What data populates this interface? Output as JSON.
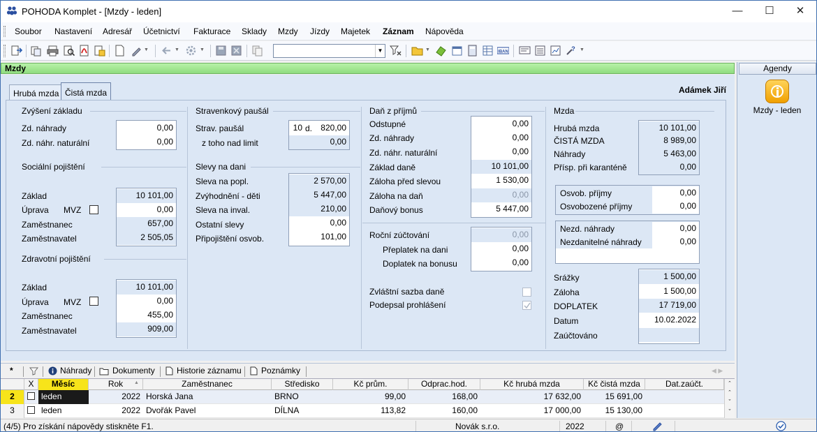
{
  "window": {
    "title": "POHODA Komplet - [Mzdy - leden]"
  },
  "menu": [
    "Soubor",
    "Nastavení",
    "Adresář",
    "Účetnictví",
    "Fakturace",
    "Sklady",
    "Mzdy",
    "Jízdy",
    "Majetek",
    "Záznam",
    "Nápověda"
  ],
  "module_title": "Mzdy",
  "tabs": [
    "Hrubá mzda",
    "Čistá mzda"
  ],
  "employee_name": "Adámek Jiří",
  "zvyseni": {
    "title": "Zvýšení základu",
    "rows": [
      {
        "label": "Zd. náhrady",
        "value": "0,00"
      },
      {
        "label": "Zd. náhr. naturální",
        "value": "0,00"
      }
    ]
  },
  "socialni": {
    "title": "Sociální pojištění",
    "rows": [
      {
        "label": "Základ",
        "value": "10 101,00"
      },
      {
        "label": "Úprava",
        "value": "0,00"
      },
      {
        "label": "Zaměstnanec",
        "value": "657,00"
      },
      {
        "label": "Zaměstnavatel",
        "value": "2 505,05"
      }
    ],
    "mvz": "MVZ"
  },
  "zdravotni": {
    "title": "Zdravotní pojištění",
    "rows": [
      {
        "label": "Základ",
        "value": "10 101,00"
      },
      {
        "label": "Úprava",
        "value": "0,00"
      },
      {
        "label": "Zaměstnanec",
        "value": "455,00"
      },
      {
        "label": "Zaměstnavatel",
        "value": "909,00"
      }
    ],
    "mvz": "MVZ"
  },
  "stravenky": {
    "title": "Stravenkový paušál",
    "rows": [
      {
        "label": "Strav. paušál",
        "days": "10",
        "unit": "d.",
        "value": "820,00"
      },
      {
        "label": "z toho nad limit",
        "value": "0,00"
      }
    ]
  },
  "slevy": {
    "title": "Slevy na dani",
    "rows": [
      {
        "label": "Sleva na popl.",
        "value": "2 570,00"
      },
      {
        "label": "Zvýhodnění - děti",
        "value": "5 447,00"
      },
      {
        "label": "Sleva na inval.",
        "value": "210,00"
      },
      {
        "label": "Ostatní slevy",
        "value": "0,00"
      },
      {
        "label": "Připojištění osvob.",
        "value": "101,00"
      }
    ]
  },
  "dan": {
    "title": "Daň z příjmů",
    "rows": [
      {
        "label": "Odstupné",
        "value": "0,00"
      },
      {
        "label": "Zd. náhrady",
        "value": "0,00"
      },
      {
        "label": "Zd. náhr. naturální",
        "value": "0,00"
      },
      {
        "label": "Základ daně",
        "value": "10 101,00"
      },
      {
        "label": "Záloha před slevou",
        "value": "1 530,00"
      },
      {
        "label": "Záloha na daň",
        "value": "0,00"
      },
      {
        "label": "Daňový bonus",
        "value": "5 447,00"
      }
    ]
  },
  "rocni": {
    "rows": [
      {
        "label": "Roční zúčtování",
        "value": "0,00"
      },
      {
        "label": "Přeplatek na dani",
        "value": "0,00"
      },
      {
        "label": "Doplatek na bonusu",
        "value": "0,00"
      }
    ]
  },
  "zvlastni": {
    "label": "Zvláštní sazba daně"
  },
  "podepsal": {
    "label": "Podepsal prohlášení"
  },
  "mzda": {
    "title": "Mzda",
    "rows": [
      {
        "label": "Hrubá mzda",
        "value": "10 101,00"
      },
      {
        "label": "ČISTÁ MZDA",
        "value": "8 989,00"
      },
      {
        "label": "Náhrady",
        "value": "5 463,00"
      },
      {
        "label": "Přísp. při karanténě",
        "value": "0,00"
      }
    ]
  },
  "osvob": {
    "rows": [
      {
        "label": "Osvob. příjmy",
        "value": "0,00"
      },
      {
        "label": "Osvobozené příjmy",
        "value": "0,00"
      }
    ]
  },
  "nezd": {
    "rows": [
      {
        "label": "Nezd. náhrady",
        "value": "0,00"
      },
      {
        "label": "Nezdanitelné náhrady",
        "value": "0,00"
      }
    ]
  },
  "srazky": {
    "rows": [
      {
        "label": "Srážky",
        "value": "1 500,00"
      },
      {
        "label": "Záloha",
        "value": "1 500,00"
      },
      {
        "label": "DOPLATEK",
        "value": "17 719,00"
      },
      {
        "label": "Datum",
        "value": "10.02.2022"
      },
      {
        "label": "Zaúčtováno",
        "value": ""
      }
    ]
  },
  "bottom_tabs": [
    "Náhrady",
    "Dokumenty",
    "Historie záznamu",
    "Poznámky"
  ],
  "grid": {
    "headers": [
      "X",
      "Měsíc",
      "Rok",
      "Zaměstnanec",
      "Středisko",
      "Kč prům.",
      "Odprac.hod.",
      "Kč hrubá mzda",
      "Kč čistá mzda",
      "Dat.zaúčt."
    ],
    "rows": [
      {
        "num": "2",
        "mesic": "leden",
        "rok": "2022",
        "zam": "Horská Jana",
        "stredisko": "BRNO",
        "prum": "99,00",
        "hod": "168,00",
        "hruba": "17 632,00",
        "cista": "15 691,00",
        "dat": ""
      },
      {
        "num": "3",
        "mesic": "leden",
        "rok": "2022",
        "zam": "Dvořák Pavel",
        "stredisko": "DÍLNA",
        "prum": "113,82",
        "hod": "160,00",
        "hruba": "17 000,00",
        "cista": "15 130,00",
        "dat": ""
      }
    ]
  },
  "agendy": {
    "title": "Agendy",
    "item": "Mzdy - leden"
  },
  "status": {
    "help": "(4/5) Pro získání nápovědy stiskněte F1.",
    "company": "Novák s.r.o.",
    "year": "2022",
    "at": "@"
  },
  "colors": {
    "accent": "#dce7f5",
    "module": "#a3e89a",
    "selected_row": "#fff7b0"
  }
}
